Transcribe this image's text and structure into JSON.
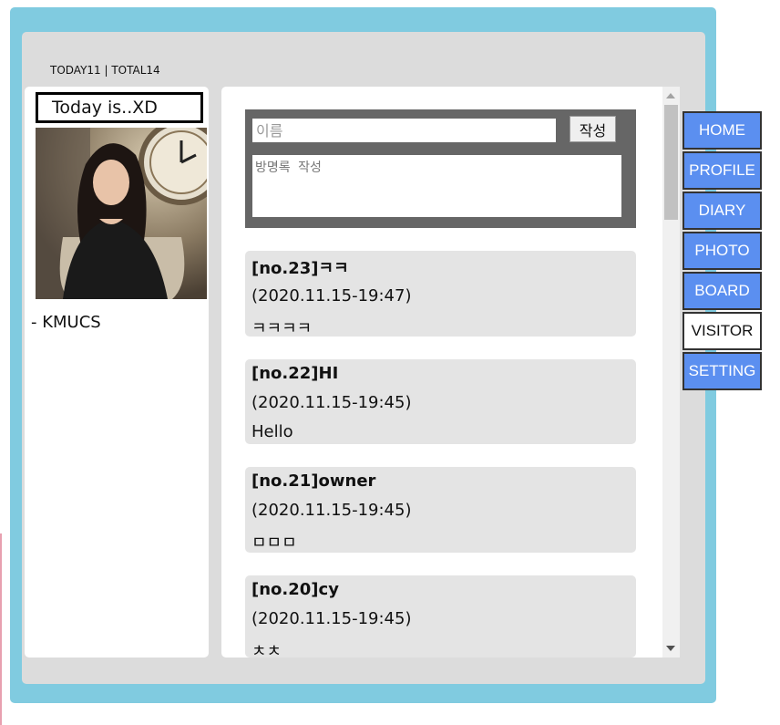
{
  "counter": "TODAY11 | TOTAL14",
  "sidebar": {
    "today_label": "Today is..XD",
    "profile_name": "-  KMUCS"
  },
  "form": {
    "name_placeholder": "이름",
    "submit_label": "작성",
    "content_placeholder": "방명록 작성"
  },
  "entries": [
    {
      "title": "[no.23]ㅋㅋ",
      "date": "(2020.11.15-19:47)",
      "body": "ㅋㅋㅋㅋ"
    },
    {
      "title": "[no.22]HI",
      "date": "(2020.11.15-19:45)",
      "body": "Hello"
    },
    {
      "title": "[no.21]owner",
      "date": "(2020.11.15-19:45)",
      "body": "ㅁㅁㅁ"
    },
    {
      "title": "[no.20]cy",
      "date": "(2020.11.15-19:45)",
      "body": "ㅊㅊ"
    }
  ],
  "nav": [
    {
      "label": "HOME",
      "active": false
    },
    {
      "label": "PROFILE",
      "active": false
    },
    {
      "label": "DIARY",
      "active": false
    },
    {
      "label": "PHOTO",
      "active": false
    },
    {
      "label": "BOARD",
      "active": false
    },
    {
      "label": "VISITOR",
      "active": true
    },
    {
      "label": "SETTING",
      "active": false
    }
  ],
  "colors": {
    "frame": "#80cbe0",
    "inner": "#dcdcdc",
    "nav_bg": "#5b8ff0",
    "entry_bg": "#e4e4e4",
    "form_bg": "#666666"
  }
}
